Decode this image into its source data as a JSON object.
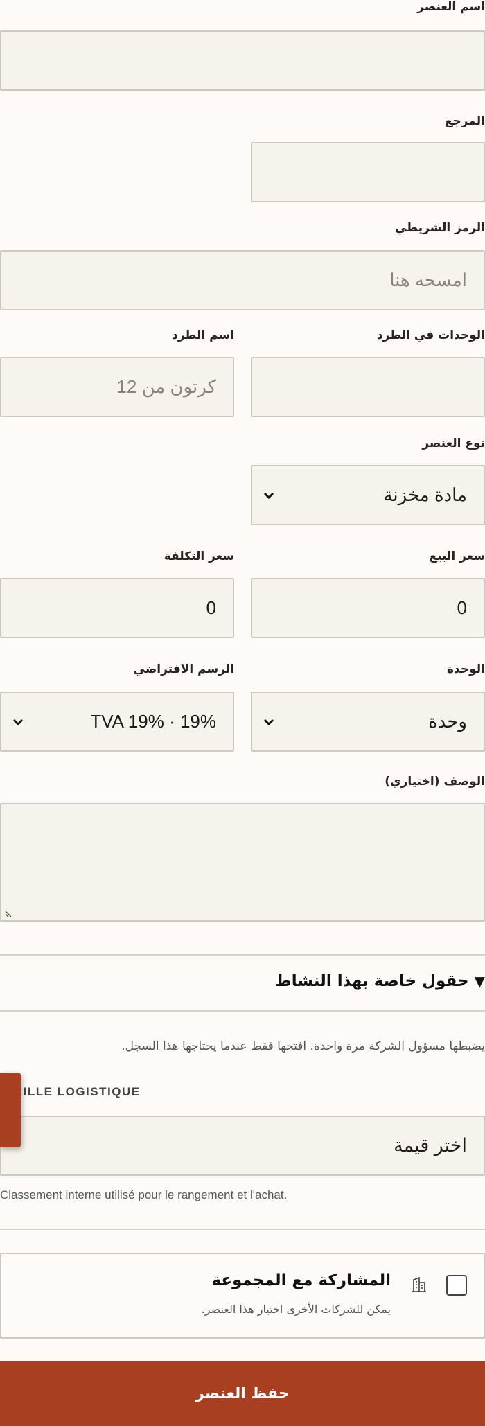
{
  "form": {
    "item_name": {
      "label": "اسم العنصر",
      "value": ""
    },
    "reference": {
      "label": "المرجع",
      "value": ""
    },
    "barcode": {
      "label": "الرمز الشريطي",
      "placeholder": "امسحه هنا"
    },
    "units_per_pack": {
      "label": "الوحدات في الطرد",
      "value": ""
    },
    "pack_name": {
      "label": "اسم الطرد",
      "placeholder": "كرتون من 12"
    },
    "item_type": {
      "label": "نوع العنصر",
      "value": "مادة مخزنة"
    },
    "sale_price": {
      "label": "سعر البيع",
      "value": "0"
    },
    "cost_price": {
      "label": "سعر التكلفة",
      "value": "0"
    },
    "unit": {
      "label": "الوحدة",
      "value": "وحدة"
    },
    "default_tax": {
      "label": "الرسم الافتراضي",
      "value": "TVA 19% · 19%"
    },
    "description": {
      "label": "الوصف (اختياري)",
      "value": ""
    }
  },
  "activity_section": {
    "title": "حقول خاصة بهذا النشاط",
    "toggle_glyph": "▼",
    "hint": "يضبطها مسؤول الشركة مرة واحدة. افتحها فقط عندما يحتاجها هذا السجل.",
    "family": {
      "label": "MILLE LOGISTIQUE",
      "value": "اختر قيمة",
      "help": "Classement interne utilisé pour le rangement et l'achat."
    }
  },
  "group_share": {
    "title": "المشاركة مع المجموعة",
    "subtitle": "يمكن للشركات الأخرى اختيار هذا العنصر.",
    "checked": false,
    "icon": "building-icon"
  },
  "save_button": {
    "label": "حفظ العنصر"
  },
  "colors": {
    "accent": "#a83f20",
    "field_bg": "#f6f2ec",
    "border": "#cfc8c0",
    "page_bg": "#fdfaf8"
  }
}
